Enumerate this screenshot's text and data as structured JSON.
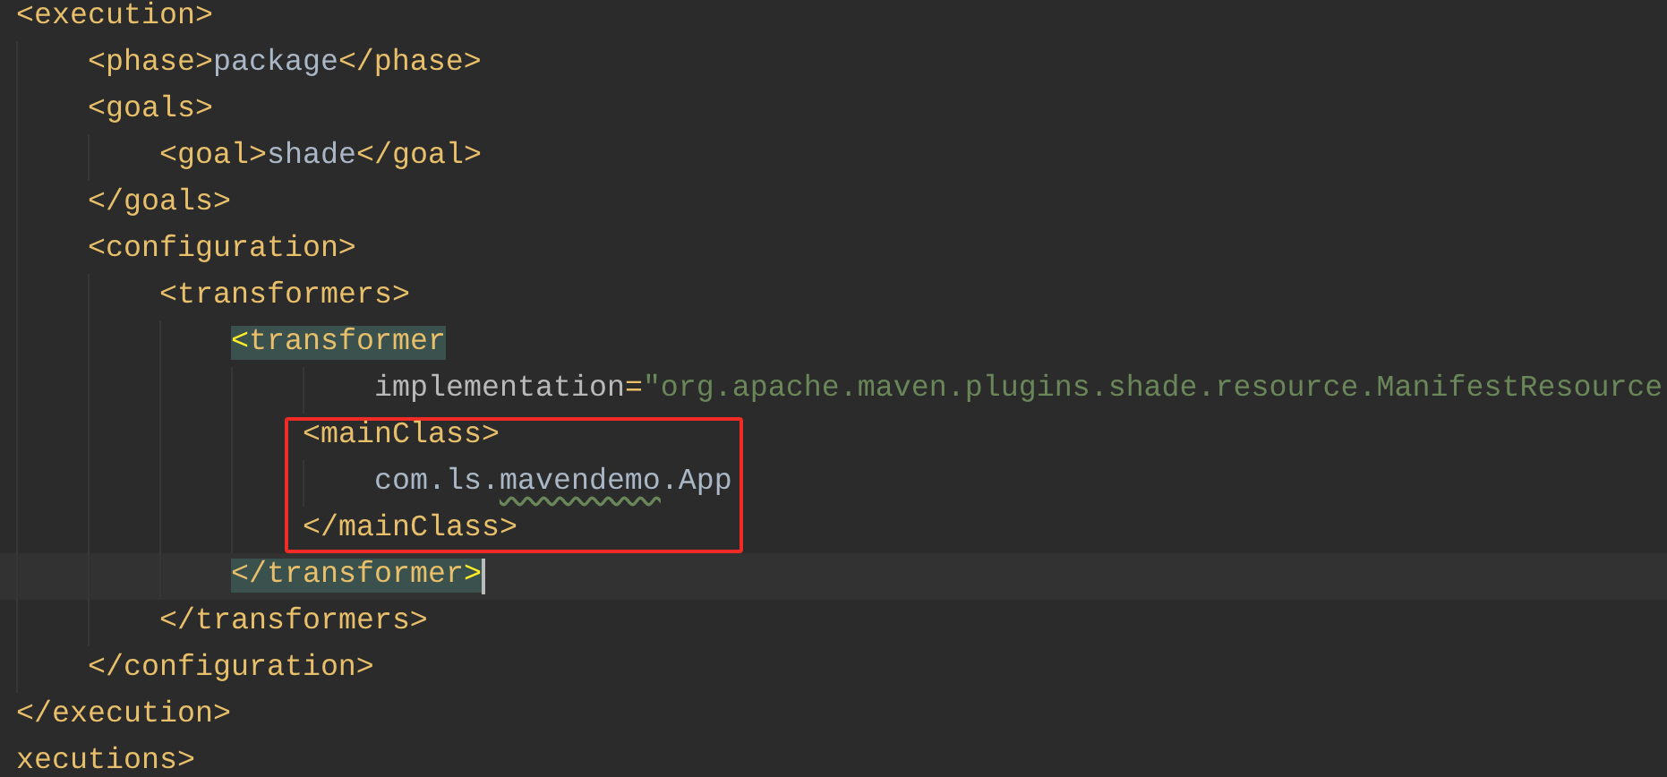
{
  "editor": {
    "lines": [
      {
        "tokens": [
          {
            "kind": "tag",
            "text": "<execution>"
          }
        ],
        "children": [
          {
            "tokens": [
              {
                "kind": "tag",
                "text": "<phase>"
              },
              {
                "kind": "text",
                "text": "package"
              },
              {
                "kind": "tag",
                "text": "</phase>"
              }
            ]
          },
          {
            "tokens": [
              {
                "kind": "tag",
                "text": "<goals>"
              }
            ],
            "children": [
              {
                "tokens": [
                  {
                    "kind": "tag",
                    "text": "<goal>"
                  },
                  {
                    "kind": "text",
                    "text": "shade"
                  },
                  {
                    "kind": "tag",
                    "text": "</goal>"
                  }
                ]
              }
            ]
          },
          {
            "tokens": [
              {
                "kind": "tag",
                "text": "</goals>"
              }
            ]
          },
          {
            "tokens": [
              {
                "kind": "tag",
                "text": "<configuration>"
              }
            ],
            "children": [
              {
                "tokens": [
                  {
                    "kind": "tag",
                    "text": "<transformers>"
                  }
                ],
                "children": [
                  {
                    "tokens": [
                      {
                        "kind": "brace",
                        "text": "<",
                        "matched": true
                      },
                      {
                        "kind": "tag",
                        "text": "transformer",
                        "matched": true
                      }
                    ],
                    "children": [
                      {
                        "kind": "continuation",
                        "tokens": [
                          {
                            "kind": "attr",
                            "text": "implementation"
                          },
                          {
                            "kind": "tag",
                            "text": "="
                          },
                          {
                            "kind": "value",
                            "text": "\"org.apache.maven.plugins.shade.resource.ManifestResource"
                          }
                        ]
                      },
                      {
                        "framed": true,
                        "tokens": [
                          {
                            "kind": "tag",
                            "text": "<mainClass>"
                          }
                        ],
                        "children": [
                          {
                            "framed": true,
                            "tokens": [
                              {
                                "kind": "text",
                                "text": "com.ls."
                              },
                              {
                                "kind": "text",
                                "text": "mavendemo",
                                "typo": true
                              },
                              {
                                "kind": "text",
                                "text": ".App"
                              }
                            ]
                          }
                        ]
                      },
                      {
                        "framed": true,
                        "tokens": [
                          {
                            "kind": "tag",
                            "text": "</mainClass>"
                          }
                        ]
                      }
                    ]
                  },
                  {
                    "current": true,
                    "tokens": [
                      {
                        "kind": "tag",
                        "text": "</transformer",
                        "matched": true
                      },
                      {
                        "kind": "brace",
                        "text": ">",
                        "matched": true
                      }
                    ]
                  }
                ]
              },
              {
                "tokens": [
                  {
                    "kind": "tag",
                    "text": "</transformers>"
                  }
                ]
              }
            ]
          },
          {
            "tokens": [
              {
                "kind": "tag",
                "text": "</configuration>"
              }
            ]
          }
        ]
      },
      {
        "tokens": [
          {
            "kind": "tag",
            "text": "</execution>"
          }
        ]
      },
      {
        "tokens": [
          {
            "kind": "tag",
            "text": "xecutions>"
          }
        ]
      }
    ]
  }
}
